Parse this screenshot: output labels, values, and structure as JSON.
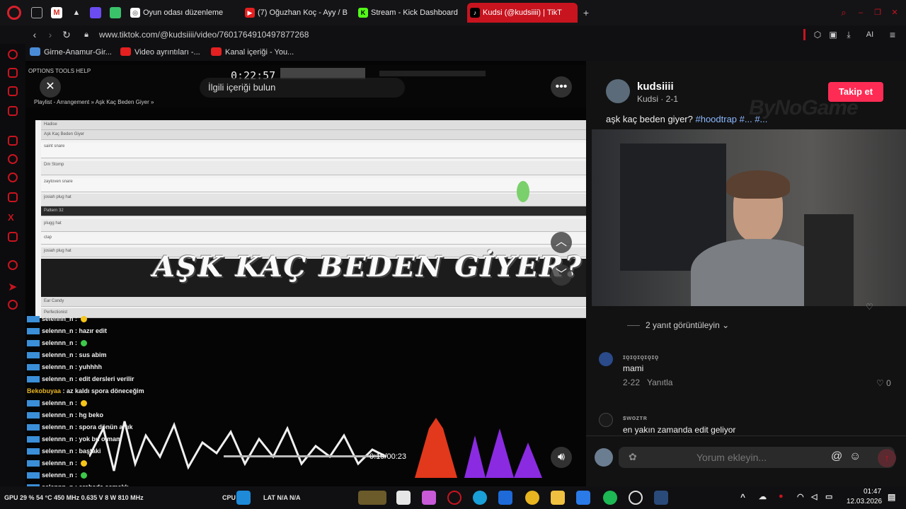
{
  "browser": {
    "tabs": [
      {
        "label": "Oyun odası düzenleme",
        "color": "#5b6cf0"
      },
      {
        "label": "(7) Oğuzhan Koç - Ayy / B",
        "color": "#e52020"
      },
      {
        "label": "Stream - Kick Dashboard",
        "color": "#53fc18"
      },
      {
        "label": "Kudsi (@kudsiiii) | TikT",
        "color": "#111111",
        "active": true
      }
    ],
    "url": "www.tiktok.com/@kudsiiii/video/7601764910497877268",
    "bookmarks": [
      "Girne-Anamur-Gir...",
      "Video ayrıntıları -...",
      "Kanal içeriği - You..."
    ],
    "ai_label": "AI"
  },
  "video": {
    "search_placeholder": "İlgili içeriği bulun",
    "daw_menu": "OPTIONS TOOLS HELP",
    "daw_time": "0:22:57",
    "daw_breadcrumb": "Playlist - Arrangement » Aşk Kaç Beden Giyer »",
    "tracks": [
      "Hadise",
      "Aşk Kaç Beden Giyer",
      "saint snare",
      "Dm Stomp",
      "zaytoven snare",
      "josiah plug hat",
      "Pattern 32",
      "plugg hat",
      "clap",
      "josiah plug hat"
    ],
    "bottom_tracks": [
      "Ear Candy",
      "Perfectionist"
    ],
    "overlay_title": "AŞK KAÇ BEDEN GİYER?",
    "time_readout": "0:19/00:23",
    "chat": [
      {
        "user": "selennn_n",
        "text": "",
        "emoji": "y"
      },
      {
        "user": "selennn_n",
        "text": "hazır edit"
      },
      {
        "user": "selennn_n",
        "text": "",
        "emoji": "g"
      },
      {
        "user": "selennn_n",
        "text": "sus abim"
      },
      {
        "user": "selennn_n",
        "text": "yuhhhh"
      },
      {
        "user": "selennn_n",
        "text": "edit dersleri verilir"
      },
      {
        "user": "Bekobuyaa",
        "text": "az kaldı spora döneceğim",
        "nobadge": true
      },
      {
        "user": "selennn_n",
        "text": "",
        "emoji": "y"
      },
      {
        "user": "selennn_n",
        "text": "hg beko"
      },
      {
        "user": "selennn_n",
        "text": "spora dönün artık"
      },
      {
        "user": "selennn_n",
        "text": "yok bu olmam"
      },
      {
        "user": "selennn_n",
        "text": "baştaki"
      },
      {
        "user": "selennn_n",
        "text": "",
        "emoji": "y"
      },
      {
        "user": "selennn_n",
        "text": "",
        "emoji": "g"
      },
      {
        "user": "selennn_n",
        "text": "arabada açmalık"
      }
    ]
  },
  "panel": {
    "username": "kudsiiii",
    "subname": "Kudsi · 2-1",
    "follow_label": "Takip et",
    "caption_text": "aşk kaç beden giyer?",
    "caption_tag": "#hoodtrap #... #...",
    "watermark": "ByNoGame",
    "replies_label": "2 yanıt görüntüleyin",
    "comments": [
      {
        "name": "ɪǫɪǫɪǫɪǫɪǫ",
        "text": "mami",
        "date": "2-22",
        "reply": "Yanıtla",
        "likes": "0"
      },
      {
        "name": "ꜱᴡᴏᴢᴛʀ",
        "text": "en yakın zamanda edit geliyor"
      }
    ],
    "comment_placeholder": "Yorum ekleyin..."
  },
  "taskbar": {
    "gpu": "GPU 29 % 54 °C 450 MHz 0.635 V 8 W 810 MHz",
    "cpu": "CPU",
    "lat": "LAT  N/A  N/A",
    "time": "01:47",
    "date": "12.03.2026"
  }
}
